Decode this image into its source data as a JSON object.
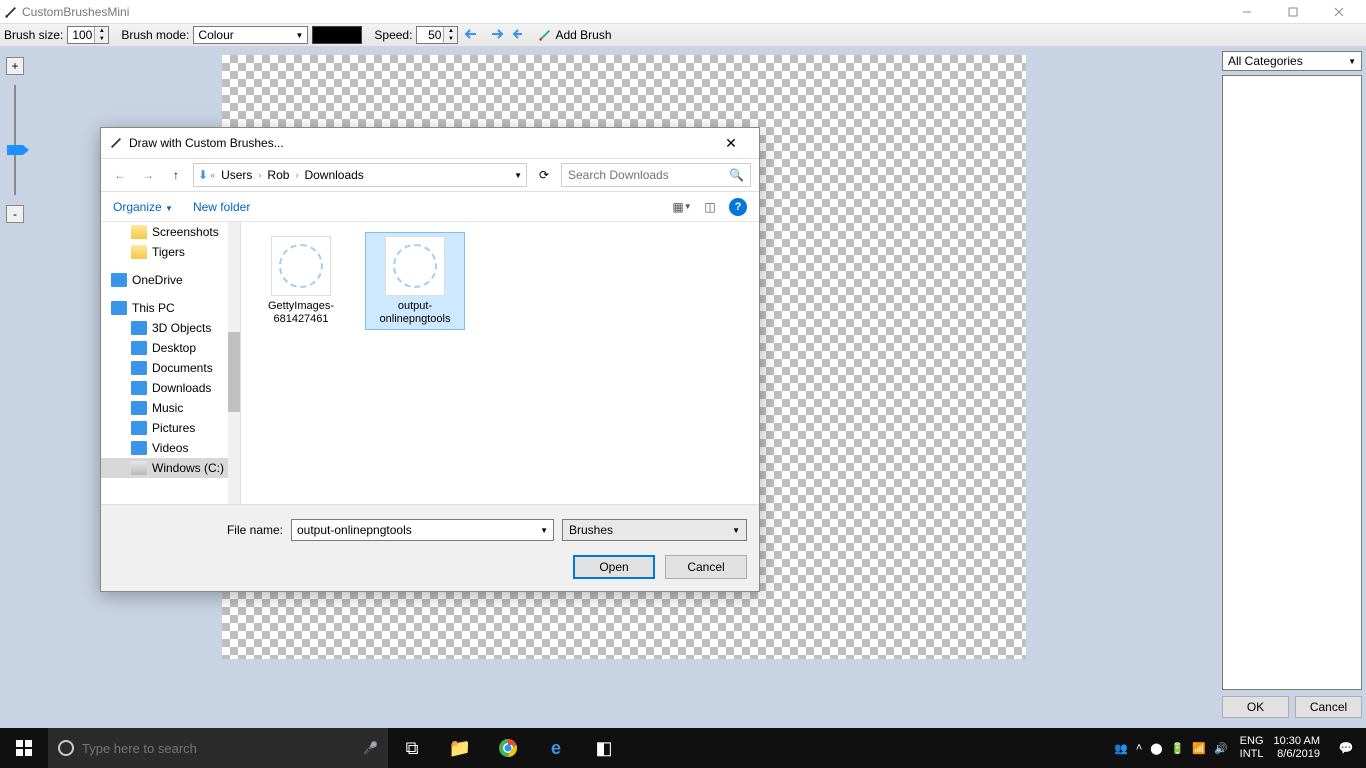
{
  "app": {
    "title": "CustomBrushesMini"
  },
  "toolbar": {
    "brush_size_label": "Brush size:",
    "brush_size_value": "100",
    "brush_mode_label": "Brush mode:",
    "brush_mode_value": "Colour",
    "speed_label": "Speed:",
    "speed_value": "50",
    "add_brush_label": "Add Brush"
  },
  "right_panel": {
    "categories_label": "All Categories",
    "ok_label": "OK",
    "cancel_label": "Cancel"
  },
  "dialog": {
    "title": "Draw with Custom Brushes...",
    "breadcrumb": [
      "Users",
      "Rob",
      "Downloads"
    ],
    "search_placeholder": "Search Downloads",
    "organize_label": "Organize",
    "new_folder_label": "New folder",
    "tree": [
      {
        "label": "Screenshots",
        "icon": "folder",
        "lvl": 1
      },
      {
        "label": "Tigers",
        "icon": "folder",
        "lvl": 1
      },
      {
        "label": "OneDrive",
        "icon": "onedrive",
        "lvl": 0
      },
      {
        "label": "This PC",
        "icon": "pc",
        "lvl": 0
      },
      {
        "label": "3D Objects",
        "icon": "3d",
        "lvl": 1
      },
      {
        "label": "Desktop",
        "icon": "blue",
        "lvl": 1
      },
      {
        "label": "Documents",
        "icon": "doc",
        "lvl": 1
      },
      {
        "label": "Downloads",
        "icon": "down",
        "lvl": 1
      },
      {
        "label": "Music",
        "icon": "music",
        "lvl": 1
      },
      {
        "label": "Pictures",
        "icon": "pic",
        "lvl": 1
      },
      {
        "label": "Videos",
        "icon": "vid",
        "lvl": 1
      },
      {
        "label": "Windows (C:)",
        "icon": "drive",
        "lvl": 1,
        "sel": true
      }
    ],
    "files": [
      {
        "name": "GettyImages-681427461",
        "sel": false
      },
      {
        "name": "output-onlinepngtools",
        "sel": true
      }
    ],
    "filename_label": "File name:",
    "filename_value": "output-onlinepngtools",
    "filter_value": "Brushes",
    "open_label": "Open",
    "cancel_label": "Cancel"
  },
  "taskbar": {
    "search_placeholder": "Type here to search",
    "lang1": "ENG",
    "lang2": "INTL",
    "time": "10:30 AM",
    "date": "8/6/2019"
  }
}
